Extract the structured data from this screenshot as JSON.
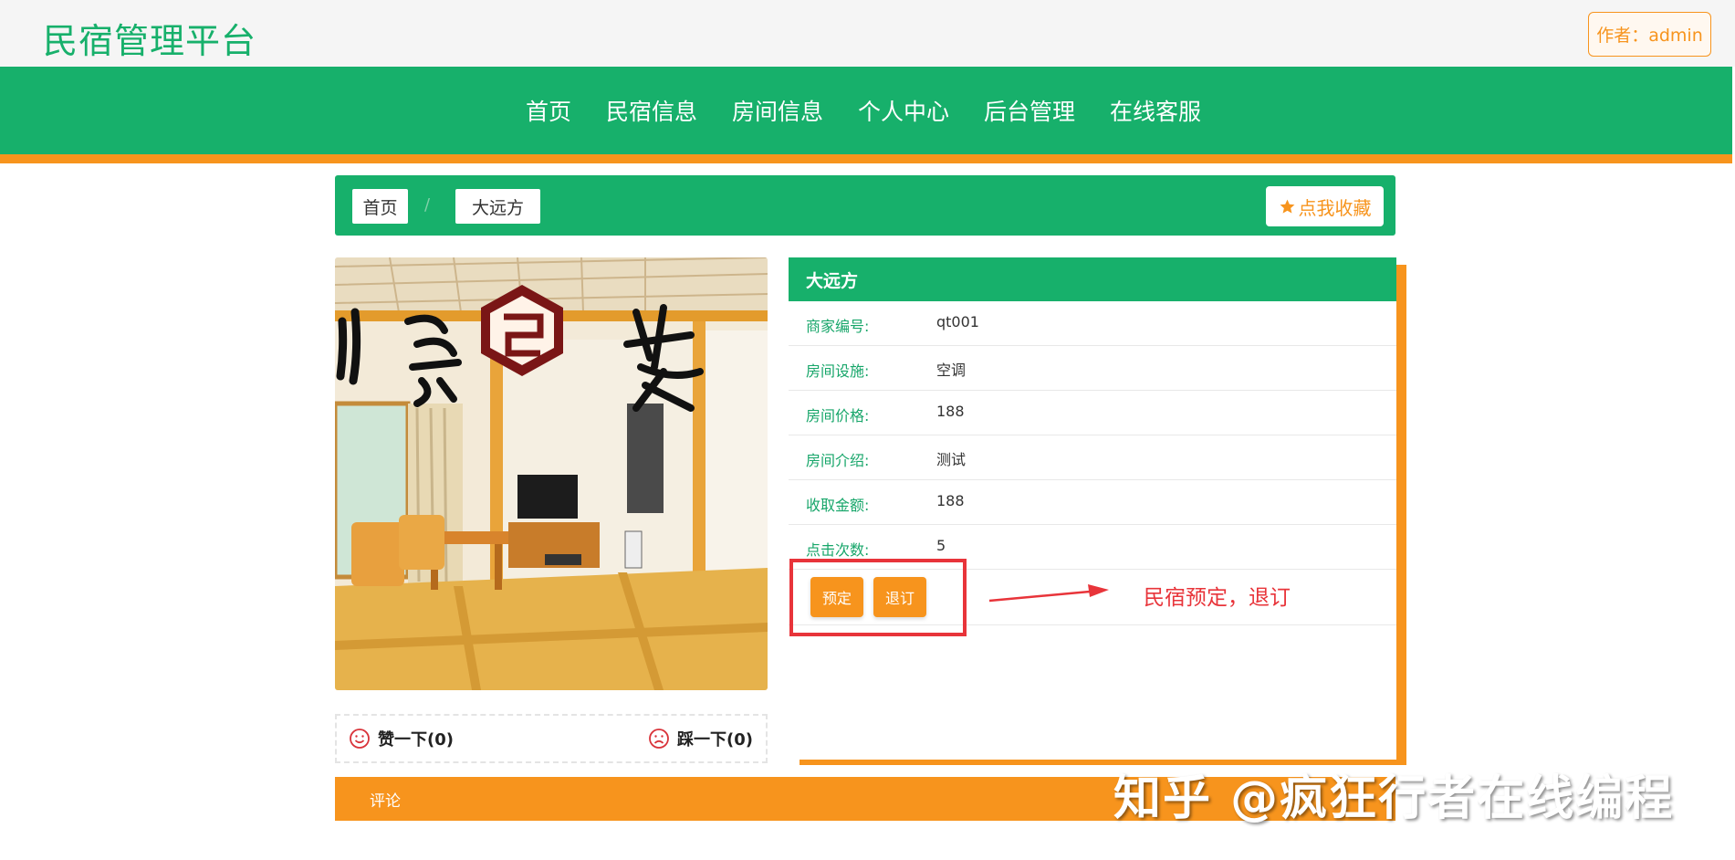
{
  "header": {
    "logo": "民宿管理平台",
    "author_button": "作者：admin"
  },
  "nav": {
    "items": [
      "首页",
      "民宿信息",
      "房间信息",
      "个人中心",
      "后台管理",
      "在线客服"
    ]
  },
  "breadcrumb": {
    "home": "首页",
    "separator": "/",
    "current": "大远方",
    "favorite_button": "点我收藏"
  },
  "detail": {
    "title": "大远方",
    "rows": [
      {
        "label": "商家编号:",
        "value": "qt001"
      },
      {
        "label": "房间设施:",
        "value": "空调"
      },
      {
        "label": "房间价格:",
        "value": "188"
      },
      {
        "label": "房间介绍:",
        "value": "测试"
      },
      {
        "label": "收取金额:",
        "value": "188"
      },
      {
        "label": "点击次数:",
        "value": "5"
      }
    ],
    "book_button": "预定",
    "cancel_button": "退订"
  },
  "annotation": "民宿预定，退订",
  "votes": {
    "like": "赞一下(0)",
    "dislike": "踩一下(0)"
  },
  "comments": {
    "label": "评论"
  },
  "watermark": "知乎 @疯狂行者在线编程",
  "colors": {
    "green": "#17b06b",
    "orange": "#f7941d",
    "red": "#e8343a"
  }
}
